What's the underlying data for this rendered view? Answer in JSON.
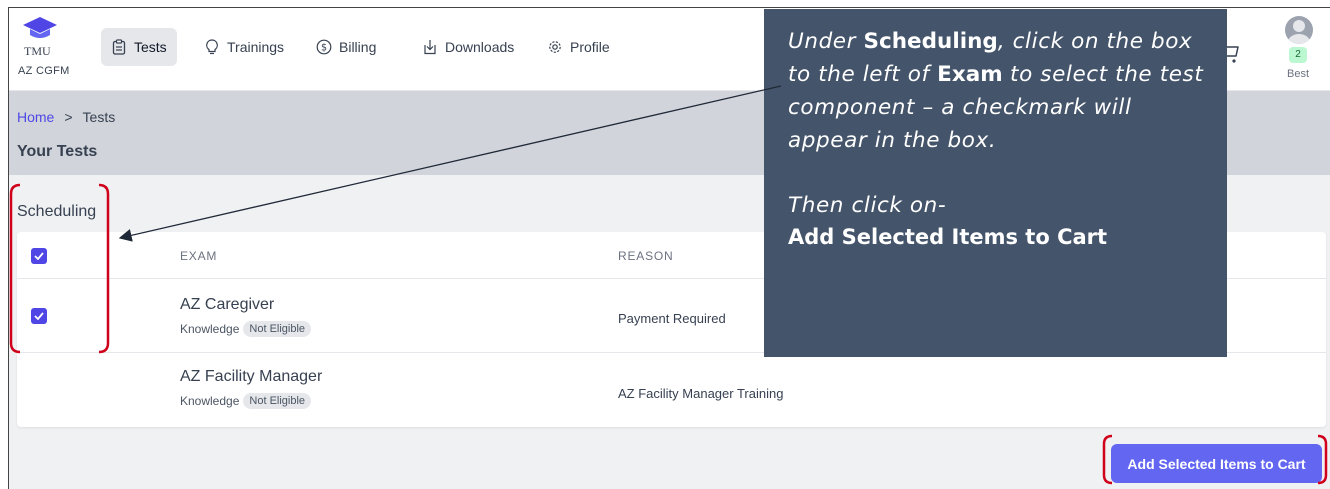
{
  "brand": {
    "name": "TMU",
    "subtitle": "AZ CGFM"
  },
  "nav": [
    {
      "label": "Tests",
      "icon": "clipboard-icon",
      "active": true
    },
    {
      "label": "Trainings",
      "icon": "lightbulb-icon"
    },
    {
      "label": "Billing",
      "icon": "dollar-icon"
    },
    {
      "label": "Downloads",
      "icon": "download-icon"
    },
    {
      "label": "Profile",
      "icon": "gear-icon"
    }
  ],
  "user": {
    "badge": "2",
    "name": "Best"
  },
  "breadcrumb": {
    "home": "Home",
    "separator": ">",
    "current": "Tests"
  },
  "page_title": "Your Tests",
  "section_title": "Scheduling",
  "table": {
    "headers": {
      "exam": "EXAM",
      "reason": "REASON"
    },
    "rows": [
      {
        "name": "AZ Caregiver",
        "type": "Knowledge",
        "status": "Not Eligible",
        "reason": "Payment Required",
        "checked": true
      },
      {
        "name": "AZ Facility Manager",
        "type": "Knowledge",
        "status": "Not Eligible",
        "reason": "AZ Facility Manager Training",
        "checked": false
      }
    ]
  },
  "cart_button": "Add Selected Items to Cart",
  "callout": {
    "p1_a": "Under ",
    "p1_b": "Scheduling",
    "p1_c": ", click on the box to the left of ",
    "p1_d": "Exam",
    "p1_e": " to select the test component – a checkmark will appear in the box.",
    "p2": "Then click on-",
    "p3": "Add Selected Items to Cart"
  },
  "colors": {
    "accent": "#6366f1",
    "callout_bg": "#44546a",
    "annotation_red": "#d0021b"
  }
}
